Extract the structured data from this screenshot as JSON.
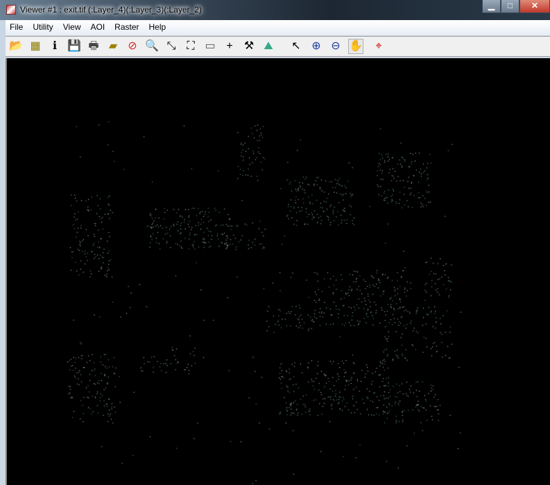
{
  "window": {
    "title": "Viewer #1 : exit.tif (:Layer_4)(:Layer_3)(:Layer_2)",
    "minimize": "▁",
    "maximize": "□",
    "close": "✕"
  },
  "menu": [
    "File",
    "Utility",
    "View",
    "AOI",
    "Raster",
    "Help"
  ],
  "toolbar": [
    {
      "name": "open-icon",
      "glyph": "📂"
    },
    {
      "name": "open-layer-icon",
      "glyph": "▦"
    },
    {
      "name": "info-icon",
      "glyph": "ℹ"
    },
    {
      "name": "save-icon",
      "glyph": "💾"
    },
    {
      "name": "print-icon",
      "glyph": "🖶"
    },
    {
      "name": "eraser-icon",
      "glyph": "▰"
    },
    {
      "name": "clear-view-icon",
      "glyph": "⊘"
    },
    {
      "name": "inquire-icon",
      "glyph": "🔍"
    },
    {
      "name": "zoom-in-fit-icon",
      "glyph": "⤡"
    },
    {
      "name": "fit-window-icon",
      "glyph": "⛶"
    },
    {
      "name": "measure-icon",
      "glyph": "▭"
    },
    {
      "name": "crosshair-icon",
      "glyph": "+"
    },
    {
      "name": "tools-icon",
      "glyph": "⚒"
    },
    {
      "name": "profile-icon",
      "glyph": "⛰"
    },
    {
      "name": "select-arrow-icon",
      "glyph": "↖"
    },
    {
      "name": "zoom-in-icon",
      "glyph": "⊕"
    },
    {
      "name": "zoom-out-icon",
      "glyph": "⊖"
    },
    {
      "name": "pan-hand-icon",
      "glyph": "✋"
    },
    {
      "name": "inquire-cursor-icon",
      "glyph": "⌖"
    }
  ],
  "colors": {
    "pixel_a": "#a8d8c8",
    "pixel_b": "#e0e0e0",
    "pixel_c": "#60b0a0"
  }
}
